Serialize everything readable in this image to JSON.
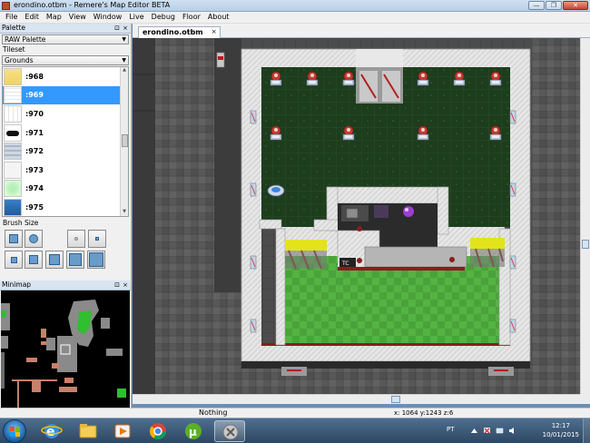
{
  "window": {
    "title": "erondino.otbm - Remere's Map Editor BETA",
    "controls": {
      "minimize": "—",
      "maximize": "❐",
      "close": "✕"
    }
  },
  "menu": [
    "File",
    "Edit",
    "Map",
    "View",
    "Window",
    "Live",
    "Debug",
    "Floor",
    "About"
  ],
  "palette": {
    "header": "Palette",
    "pin": "⊡",
    "close": "×",
    "type_combo": "RAW Palette",
    "tileset_label": "Tileset",
    "tileset_combo": "Grounds",
    "items": [
      {
        "label": ":968",
        "selected": false
      },
      {
        "label": ":969",
        "selected": true
      },
      {
        "label": ":970",
        "selected": false
      },
      {
        "label": ":971",
        "selected": false
      },
      {
        "label": ":972",
        "selected": false
      },
      {
        "label": ":973",
        "selected": false
      },
      {
        "label": ":974",
        "selected": false
      },
      {
        "label": ":975",
        "selected": false
      }
    ],
    "brush_size_label": "Brush Size"
  },
  "minimap": {
    "header": "Minimap",
    "pin": "⊡",
    "close": "×"
  },
  "tabs": [
    {
      "label": "erondino.otbm",
      "close": "×"
    }
  ],
  "status": {
    "message": "Nothing",
    "coords": "x: 1064 y:1243 z:6"
  },
  "taskbar": {
    "language": "PT",
    "time": "12:17",
    "date": "10/01/2015"
  },
  "colors": {
    "title_bar": "#b7cfe7",
    "selection": "#3399ff",
    "grass_dark": "#1d3d1d",
    "grass_light": "#4aa33a",
    "wall": "#e8e8e8",
    "stone": "#5a5a5a"
  }
}
